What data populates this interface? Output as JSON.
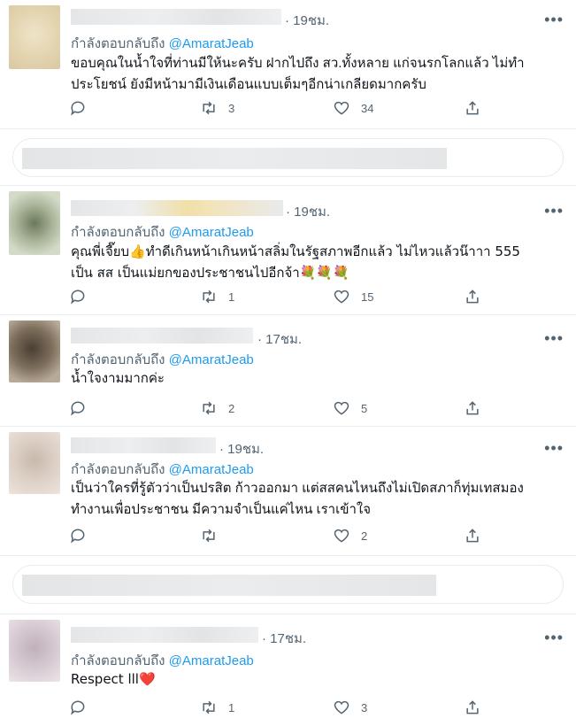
{
  "tweets": [
    {
      "time": "· 19ชม.",
      "reply_prefix": "กำลังตอบกลับถึง",
      "reply_handle": "@AmaratJeab",
      "text_lines": [
        "ขอบคุณในน้ำใจที่ท่านมีให้นะครับ ฝากไปถึง สว.ทั้งหลาย แก่จนรกโลกแล้ว ไม่ทำ",
        "ประโยชน์ ยังมีหน้ามามีเงินเดือนแบบเต็มๆอีกน่าเกลียดมากครับ"
      ],
      "retweets": "3",
      "likes": "34"
    },
    {
      "time": "· 19ชม.",
      "reply_prefix": "กำลังตอบกลับถึง",
      "reply_handle": "@AmaratJeab",
      "text_lines": [
        "คุณพี่เจี๊ยบ👍ทำดีเกินหน้าเกินหน้าสลิ่มในรัฐสภาพอีกแล้ว ไม่ไหวแล้วน๊าาา 555",
        "เป็น สส เป็นแม่ยกของประชาชนไปอีกจ้า💐💐💐"
      ],
      "retweets": "1",
      "likes": "15"
    },
    {
      "time": "· 17ชม.",
      "reply_prefix": "กำลังตอบกลับถึง",
      "reply_handle": "@AmaratJeab",
      "text_lines": [
        "น้ำใจงามมากค่ะ"
      ],
      "retweets": "2",
      "likes": "5"
    },
    {
      "time": "· 19ชม.",
      "reply_prefix": "กำลังตอบกลับถึง",
      "reply_handle": "@AmaratJeab",
      "text_lines": [
        "เป็นว่าใครที่รู้ตัวว่าเป็นปรสิต ก้าวออกมา แต่สสคนไหนถึงไม่เปิดสภาก็ทุ่มเทสมอง",
        "ทำงานเพื่อประชาชน มีความจำเป็นแค่ไหน เราเข้าใจ"
      ],
      "retweets": "",
      "likes": "2"
    },
    {
      "time": "· 17ชม.",
      "reply_prefix": "กำลังตอบกลับถึง",
      "reply_handle": "@AmaratJeab",
      "text_lines": [
        "Respect lll❤️"
      ],
      "retweets": "1",
      "likes": "3"
    }
  ],
  "more_label": "•••",
  "icons": [
    "reply-icon",
    "retweet-icon",
    "like-icon",
    "share-icon"
  ],
  "colors": {
    "handle": "#1d9bf0",
    "secondary": "#536471",
    "border": "#e6ecf0"
  }
}
